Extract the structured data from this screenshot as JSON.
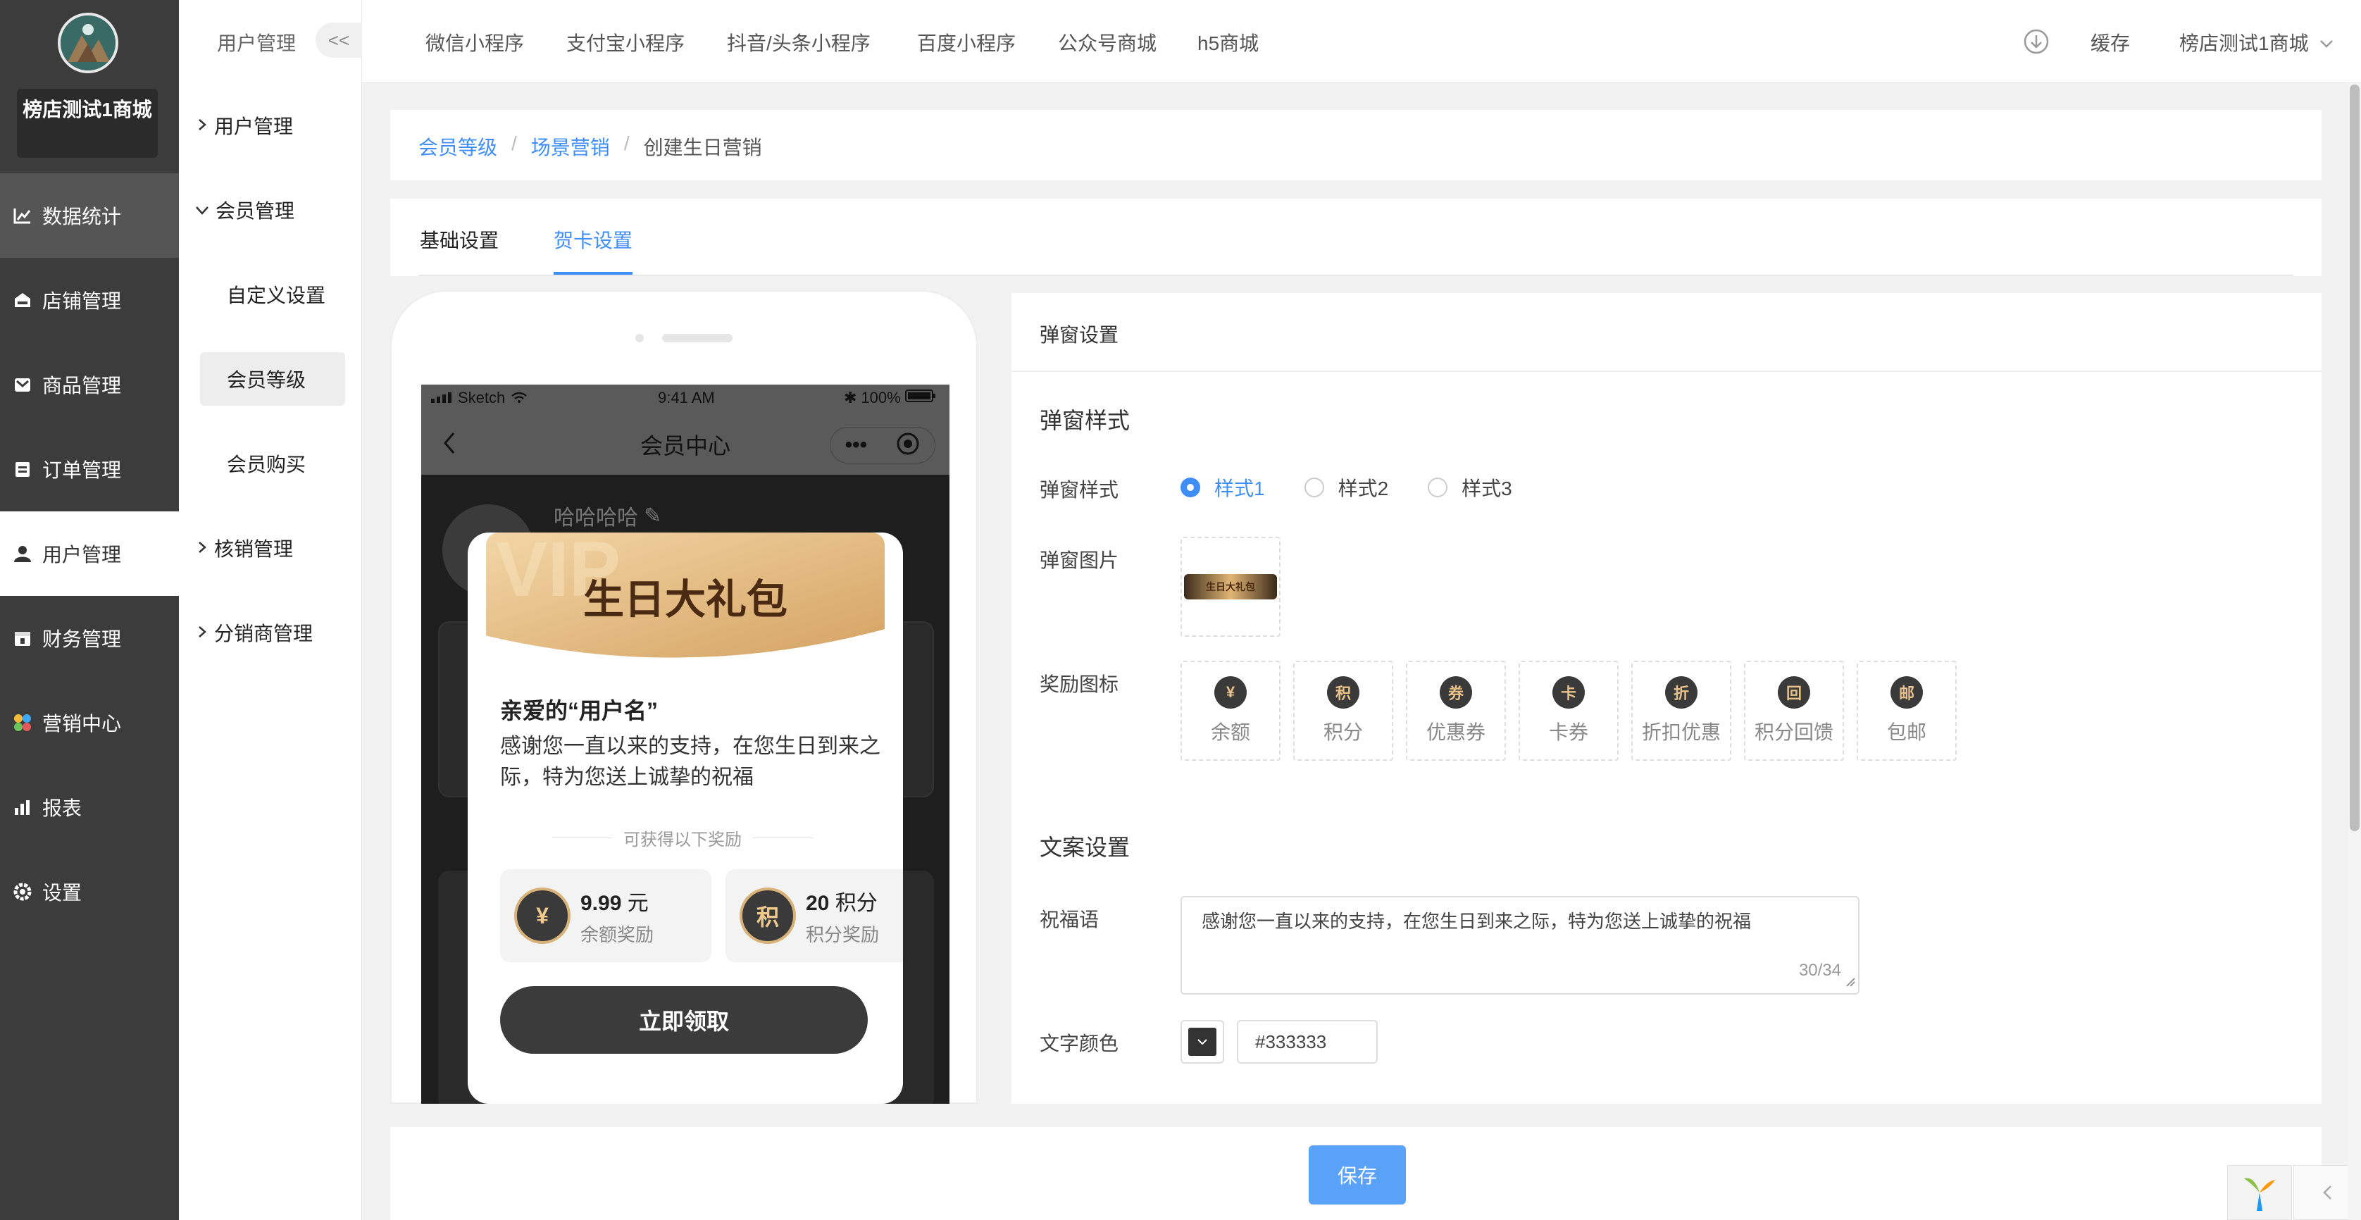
{
  "sidebar": {
    "shop_name": "榜店测试1商城",
    "items": [
      {
        "label": "数据统计",
        "icon": "chart-icon"
      },
      {
        "label": "店铺管理",
        "icon": "store-icon"
      },
      {
        "label": "商品管理",
        "icon": "goods-icon"
      },
      {
        "label": "订单管理",
        "icon": "order-icon"
      },
      {
        "label": "用户管理",
        "icon": "user-icon"
      },
      {
        "label": "财务管理",
        "icon": "finance-icon"
      },
      {
        "label": "营销中心",
        "icon": "marketing-icon"
      },
      {
        "label": "报表",
        "icon": "report-icon"
      },
      {
        "label": "设置",
        "icon": "settings-icon"
      }
    ]
  },
  "subnav": {
    "title": "用户管理",
    "collapse": "<<",
    "groups": [
      {
        "label": "用户管理"
      },
      {
        "label": "会员管理"
      },
      {
        "label": "核销管理"
      },
      {
        "label": "分销商管理"
      }
    ],
    "member_items": [
      "自定义设置",
      "会员等级",
      "会员购买"
    ]
  },
  "topbar": {
    "tabs": [
      "微信小程序",
      "支付宝小程序",
      "抖音/头条小程序",
      "百度小程序",
      "公众号商城",
      "h5商城"
    ],
    "cache": "缓存",
    "store": "榜店测试1商城"
  },
  "breadcrumb": [
    "会员等级",
    "场景营销",
    "创建生日营销"
  ],
  "page_tabs": [
    "基础设置",
    "贺卡设置"
  ],
  "phone": {
    "carrier": "Sketch",
    "time": "9:41 AM",
    "battery": "100%",
    "nav_title": "会员中心",
    "username": "哈哈哈哈",
    "banner": "生日大礼包",
    "greeting": "亲爱的“用户名”",
    "message": "感谢您一直以来的支持，在您生日到来之际，特为您送上诚挚的祝福",
    "divider": "可获得以下奖励",
    "rewards": [
      {
        "value": "9.99",
        "unit": "元",
        "desc": "余额奖励",
        "icon": "¥"
      },
      {
        "value": "20",
        "unit": "积分",
        "desc": "积分奖励",
        "icon": "积"
      }
    ],
    "claim": "立即领取"
  },
  "panel": {
    "header": "弹窗设置",
    "section1": "弹窗样式",
    "style_label": "弹窗样式",
    "styles": [
      "样式1",
      "样式2",
      "样式3"
    ],
    "selected_style": "样式1",
    "image_label": "弹窗图片",
    "image_text": "生日大礼包",
    "icons_label": "奖励图标",
    "icons": [
      {
        "label": "余额",
        "glyph": "¥"
      },
      {
        "label": "积分",
        "glyph": "积"
      },
      {
        "label": "优惠券",
        "glyph": "券"
      },
      {
        "label": "卡券",
        "glyph": "卡"
      },
      {
        "label": "折扣优惠",
        "glyph": "折"
      },
      {
        "label": "积分回馈",
        "glyph": "回"
      },
      {
        "label": "包邮",
        "glyph": "邮"
      }
    ],
    "section2": "文案设置",
    "blessing_label": "祝福语",
    "blessing": "感谢您一直以来的支持，在您生日到来之际，特为您送上诚挚的祝福",
    "counter": "30/34",
    "color_label": "文字颜色",
    "color_value": "#333333"
  },
  "save": "保存",
  "colors": {
    "accent": "#3f8ef7",
    "sidebar": "#3c3c3c",
    "save": "#5aa2f8"
  }
}
